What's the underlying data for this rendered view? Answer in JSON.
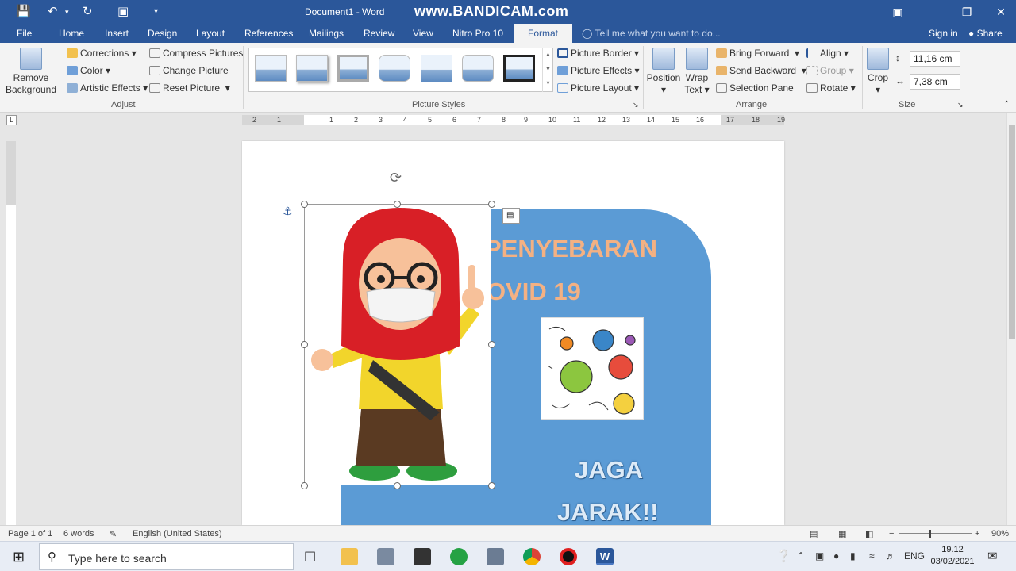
{
  "titlebar": {
    "document_title": "Document1 - Word",
    "watermark": "www.BANDICAM.com"
  },
  "tabs": [
    {
      "label": "File"
    },
    {
      "label": "Home"
    },
    {
      "label": "Insert"
    },
    {
      "label": "Design"
    },
    {
      "label": "Layout"
    },
    {
      "label": "References"
    },
    {
      "label": "Mailings"
    },
    {
      "label": "Review"
    },
    {
      "label": "View"
    },
    {
      "label": "Nitro Pro 10"
    },
    {
      "label": "Format"
    }
  ],
  "tell_me": "Tell me what you want to do...",
  "sign_in": "Sign in",
  "share": "Share",
  "ribbon": {
    "adjust": {
      "remove_background": "Remove Background",
      "corrections": "Corrections",
      "color": "Color",
      "artistic_effects": "Artistic Effects",
      "compress_pictures": "Compress Pictures",
      "change_picture": "Change Picture",
      "reset_picture": "Reset Picture",
      "label": "Adjust"
    },
    "picture_styles": {
      "label": "Picture Styles",
      "picture_border": "Picture Border",
      "picture_effects": "Picture Effects",
      "picture_layout": "Picture Layout"
    },
    "arrange": {
      "label": "Arrange",
      "position": "Position",
      "wrap_text": "Wrap Text",
      "bring_forward": "Bring Forward",
      "send_backward": "Send Backward",
      "selection_pane": "Selection Pane",
      "align": "Align",
      "group": "Group",
      "rotate": "Rotate"
    },
    "size": {
      "label": "Size",
      "crop": "Crop",
      "height": "11,16 cm",
      "width": "7,38 cm"
    }
  },
  "ruler_numbers": [
    "2",
    "1",
    "1",
    "2",
    "3",
    "4",
    "5",
    "6",
    "7",
    "8",
    "9",
    "10",
    "11",
    "12",
    "13",
    "14",
    "15",
    "16",
    "17",
    "18",
    "19"
  ],
  "document": {
    "title_line1": "PENYEBARAN",
    "title_line2": "OVID 19",
    "slogan_line1": "JAGA",
    "slogan_line2": "JARAK!!"
  },
  "statusbar": {
    "page": "Page 1 of 1",
    "words": "6 words",
    "language": "English (United States)",
    "zoom": "90%"
  },
  "taskbar": {
    "search_placeholder": "Type here to search",
    "lang": "ENG",
    "time": "19.12",
    "date": "03/02/2021"
  },
  "colors": {
    "word_blue": "#2b579a",
    "shape_blue": "#5b9bd5",
    "title_orange": "#f4b183"
  }
}
